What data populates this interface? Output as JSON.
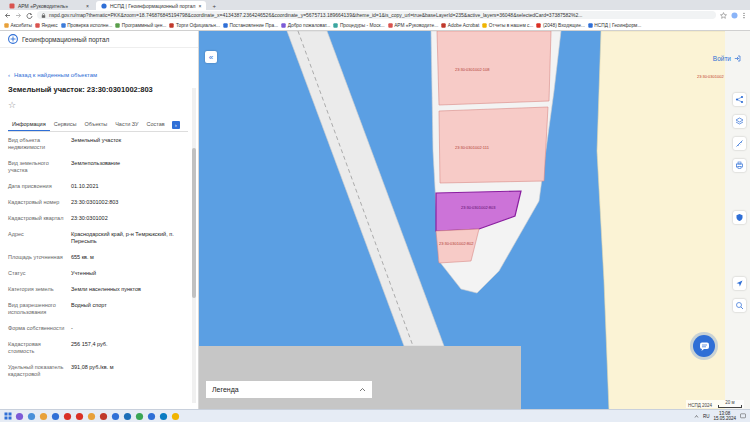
{
  "browser": {
    "tabs": [
      {
        "label": "АРМ «Руководитель»",
        "close": "×",
        "selected": false
      },
      {
        "label": "НСПД | Геоинформационный портал",
        "close": "×",
        "selected": true
      }
    ],
    "new_tab": "+",
    "address": "nspd.gov.ru/map?thematic=PKK&zoom=18.746876845194798&coordinate_x=4134387.2364246526&coordinate_y=5675713.189664139&theme_id=1&is_copy_url=true&baseLayerId=235&active_layers=36048&selectedCard=37387582%2...",
    "bookmarks": [
      "Аксибиты",
      "Яндекс",
      "Проверка исполне...",
      "Программный цен...",
      "Торги Официальн...",
      "Постановление Пра...",
      "Добро пожаловат...",
      "Процедуры - Моск...",
      "АРМ «Руководите...",
      "Adobe Acrobat",
      "Отчеты в нашем с...",
      "(2048) Входящие...",
      "НСПД | Геоинформ..."
    ]
  },
  "app": {
    "title": "Геоинформационный портал"
  },
  "panel": {
    "back_icon": "‹",
    "back": "Назад к найденным объектам",
    "title": "Земельный участок: 23:30:0301002:803",
    "star": "☆",
    "tabs": [
      {
        "label": "Информация",
        "selected": true
      },
      {
        "label": "Сервисы",
        "selected": false
      },
      {
        "label": "Объекты",
        "selected": false
      },
      {
        "label": "Части ЗУ",
        "selected": false
      },
      {
        "label": "Состав",
        "selected": false
      }
    ],
    "more": "›",
    "fields": [
      {
        "label": "Вид объекта недвижимости",
        "value": "Земельный участок"
      },
      {
        "label": "Вид земельного участка",
        "value": "Землепользование"
      },
      {
        "label": "Дата присвоения",
        "value": "01.10.2021"
      },
      {
        "label": "Кадастровый номер",
        "value": "23:30:0301002:803"
      },
      {
        "label": "Кадастровый квартал",
        "value": "23:30:0301002"
      },
      {
        "label": "Адрес",
        "value": "Краснодарский край, р-н Темрюкский, п. Пересыпь"
      },
      {
        "label": "Площадь уточненная",
        "value": "655 кв. м"
      },
      {
        "label": "Статус",
        "value": "Учтенный"
      },
      {
        "label": "Категория земель",
        "value": "Земли населенных пунктов"
      },
      {
        "label": "Вид разрешенного использования",
        "value": "Водный спорт"
      },
      {
        "label": "Форма собственности",
        "value": "-"
      },
      {
        "label": "Кадастровая стоимость",
        "value": "256 157,4 руб."
      },
      {
        "label": "Удельный показатель кадастровой",
        "value": "391,08 руб./кв. м"
      }
    ]
  },
  "map": {
    "collapse": "«",
    "login": "Войти",
    "parcels": [
      {
        "label": "23:30:0301002:108",
        "selected": false
      },
      {
        "label": "23:30:0301002:111",
        "selected": false
      },
      {
        "label": "23:30:0301002:803",
        "selected": true
      },
      {
        "label": "23:30:0301002:802",
        "selected": false
      }
    ],
    "land_label": "23:30:0301002",
    "legend": "Легенда",
    "attribution": "НСПД 2024",
    "scale": "20 м"
  },
  "taskbar": {
    "lang": "RU",
    "time": "13:08",
    "date": "15.05.2024"
  }
}
